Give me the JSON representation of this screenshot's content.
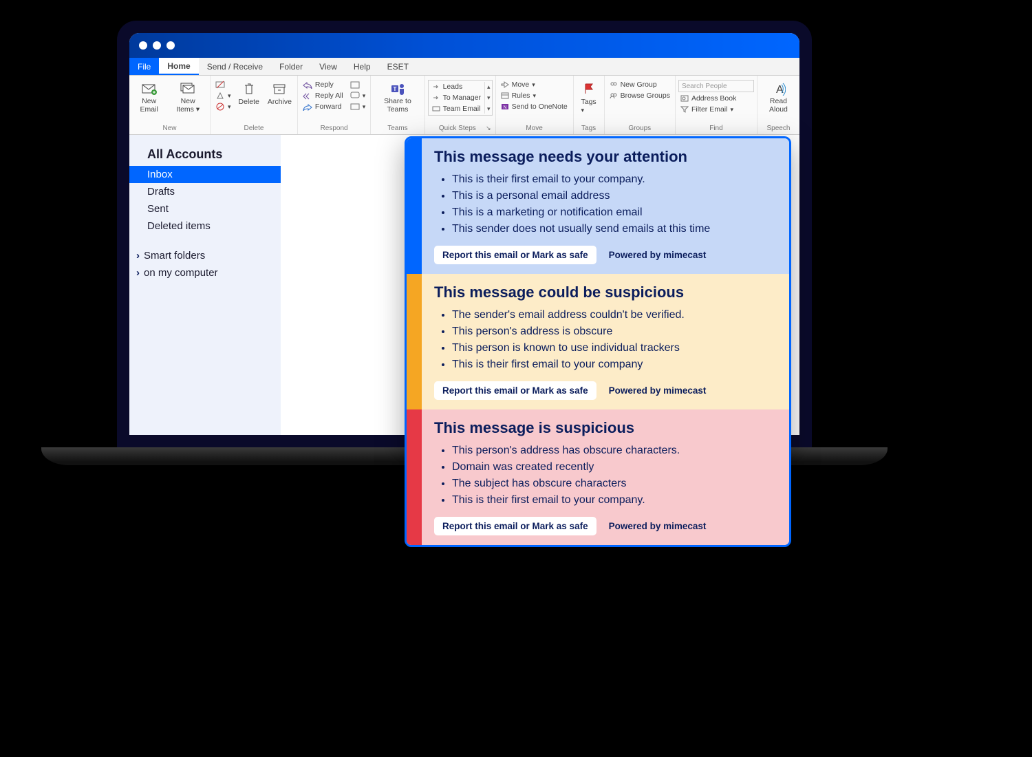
{
  "tabs": {
    "file": "File",
    "home": "Home",
    "sendrx": "Send / Receive",
    "folder": "Folder",
    "view": "View",
    "help": "Help",
    "eset": "ESET"
  },
  "ribbon": {
    "new": {
      "label": "New",
      "new_email": "New Email",
      "new_items": "New Items"
    },
    "delete": {
      "label": "Delete",
      "delete": "Delete",
      "archive": "Archive"
    },
    "respond": {
      "label": "Respond",
      "reply": "Reply",
      "reply_all": "Reply All",
      "forward": "Forward",
      "share": "Share to Teams"
    },
    "quicksteps": {
      "label": "Quick Steps",
      "leads": "Leads",
      "to_manager": "To Manager",
      "team_email": "Team Email"
    },
    "teams": {
      "label": "Teams"
    },
    "move": {
      "label": "Move",
      "move": "Move",
      "rules": "Rules",
      "onenote": "Send to OneNote"
    },
    "tags": {
      "label": "Tags",
      "tags": "Tags"
    },
    "groups": {
      "label": "Groups",
      "new_group": "New Group",
      "browse_groups": "Browse Groups"
    },
    "find": {
      "label": "Find",
      "search": "Search People",
      "address_book": "Address Book",
      "filter": "Filter Email"
    },
    "speech": {
      "label": "Speech",
      "read_aloud": "Read Aloud"
    }
  },
  "folders": {
    "heading": "All Accounts",
    "inbox": "Inbox",
    "drafts": "Drafts",
    "sent": "Sent",
    "deleted": "Deleted items",
    "smart": "Smart folders",
    "computer": "on my computer"
  },
  "alerts": {
    "blue": {
      "title": "This message needs your attention",
      "b1": "This is their first email to your company.",
      "b2": "This is a personal email address",
      "b3": "This is a marketing or notification email",
      "b4": "This sender does not usually send emails at this time",
      "button": "Report this email or Mark as safe",
      "powered": "Powered by mimecast"
    },
    "yellow": {
      "title": "This message could be suspicious",
      "b1": "The sender's email address couldn't be verified.",
      "b2": "This person's address is obscure",
      "b3": "This person is known to use individual trackers",
      "b4": "This is their first email to your company",
      "button": "Report this email or Mark as safe",
      "powered": "Powered by mimecast"
    },
    "red": {
      "title": "This message is suspicious",
      "b1": "This person's address has obscure characters.",
      "b2": "Domain was created recently",
      "b3": "The subject has obscure characters",
      "b4": "This is their first email to your company.",
      "button": "Report this email or Mark as safe",
      "powered": "Powered by mimecast"
    }
  }
}
